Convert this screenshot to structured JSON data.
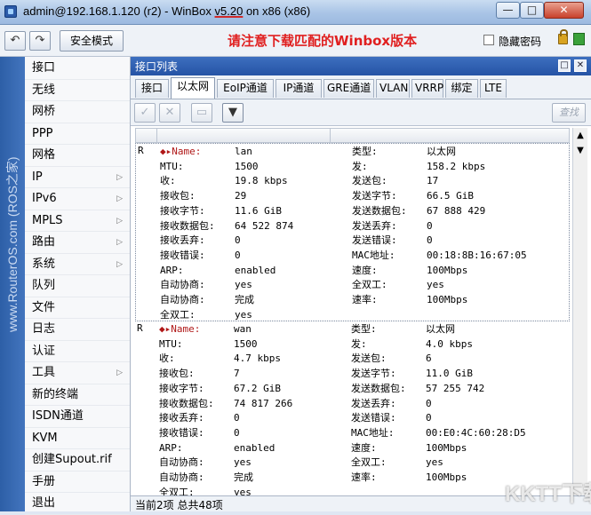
{
  "window": {
    "title_prefix": "admin@192.168.1.120 (r2) - WinBox ",
    "title_version": "v5.20",
    "title_suffix": " on x86 (x86)",
    "min": "—",
    "max": "□",
    "close": "✕"
  },
  "toolbar": {
    "undo": "↶",
    "redo": "↷",
    "safe_mode": "安全模式",
    "notice": "请注意下载匹配的Winbox版本",
    "hide_passwords": "隐藏密码"
  },
  "side_strip": "www.RouterOS.com (ROS之家)",
  "menu": [
    {
      "label": "接口",
      "arrow": ""
    },
    {
      "label": "无线",
      "arrow": ""
    },
    {
      "label": "网桥",
      "arrow": ""
    },
    {
      "label": "PPP",
      "arrow": ""
    },
    {
      "label": "网格",
      "arrow": ""
    },
    {
      "label": "IP",
      "arrow": "▷"
    },
    {
      "label": "IPv6",
      "arrow": "▷"
    },
    {
      "label": "MPLS",
      "arrow": "▷"
    },
    {
      "label": "路由",
      "arrow": "▷"
    },
    {
      "label": "系统",
      "arrow": "▷"
    },
    {
      "label": "队列",
      "arrow": ""
    },
    {
      "label": "文件",
      "arrow": ""
    },
    {
      "label": "日志",
      "arrow": ""
    },
    {
      "label": "认证",
      "arrow": ""
    },
    {
      "label": "工具",
      "arrow": "▷"
    },
    {
      "label": "新的终端",
      "arrow": ""
    },
    {
      "label": "ISDN通道",
      "arrow": ""
    },
    {
      "label": "KVM",
      "arrow": ""
    },
    {
      "label": "创建Supout.rif",
      "arrow": ""
    },
    {
      "label": "手册",
      "arrow": ""
    },
    {
      "label": "退出",
      "arrow": ""
    }
  ],
  "interface_window": {
    "title": "接口列表",
    "restore": "□",
    "close": "✕",
    "tabs": [
      "接口",
      "以太网",
      "EoIP通道",
      "IP通道",
      "GRE通道",
      "VLAN",
      "VRRP",
      "绑定",
      "LTE"
    ],
    "active_tab": 1,
    "buttons": {
      "enable": "✓",
      "disable": "✕",
      "comment": "▭",
      "filter": "▼",
      "find": "查找"
    },
    "scroll_up": "▲",
    "scroll_down": "▼",
    "status": "当前2项 总共48项"
  },
  "records": [
    {
      "flag": "R",
      "rows": [
        [
          "◆▸Name:",
          "lan",
          "类型:",
          "以太网"
        ],
        [
          "MTU:",
          "1500",
          "发:",
          "158.2 kbps"
        ],
        [
          "收:",
          "19.8 kbps",
          "发送包:",
          "17"
        ],
        [
          "接收包:",
          "29",
          "发送字节:",
          "66.5 GiB"
        ],
        [
          "接收字节:",
          "11.6 GiB",
          "发送数据包:",
          "67 888 429"
        ],
        [
          "接收数据包:",
          "64 522 874",
          "发送丢弃:",
          "0"
        ],
        [
          "接收丢弃:",
          "0",
          "发送错误:",
          "0"
        ],
        [
          "接收错误:",
          "0",
          "MAC地址:",
          "00:18:8B:16:67:05"
        ],
        [
          "ARP:",
          "enabled",
          "速度:",
          "100Mbps"
        ],
        [
          "自动协商:",
          "yes",
          "全双工:",
          "yes"
        ],
        [
          "自动协商:",
          "完成",
          "速率:",
          "100Mbps"
        ],
        [
          "全双工:",
          "yes",
          "",
          ""
        ]
      ]
    },
    {
      "flag": "R",
      "rows": [
        [
          "◆▸Name:",
          "wan",
          "类型:",
          "以太网"
        ],
        [
          "MTU:",
          "1500",
          "发:",
          "4.0 kbps"
        ],
        [
          "收:",
          "4.7 kbps",
          "发送包:",
          "6"
        ],
        [
          "接收包:",
          "7",
          "发送字节:",
          "11.0 GiB"
        ],
        [
          "接收字节:",
          "67.2 GiB",
          "发送数据包:",
          "57 255 742"
        ],
        [
          "接收数据包:",
          "74 817 266",
          "发送丢弃:",
          "0"
        ],
        [
          "接收丢弃:",
          "0",
          "发送错误:",
          "0"
        ],
        [
          "接收错误:",
          "0",
          "MAC地址:",
          "00:E0:4C:60:28:D5"
        ],
        [
          "ARP:",
          "enabled",
          "速度:",
          "100Mbps"
        ],
        [
          "自动协商:",
          "yes",
          "全双工:",
          "yes"
        ],
        [
          "自动协商:",
          "完成",
          "速率:",
          "100Mbps"
        ],
        [
          "全双工:",
          "yes",
          "",
          ""
        ]
      ]
    }
  ],
  "watermark": "KKTT下载"
}
